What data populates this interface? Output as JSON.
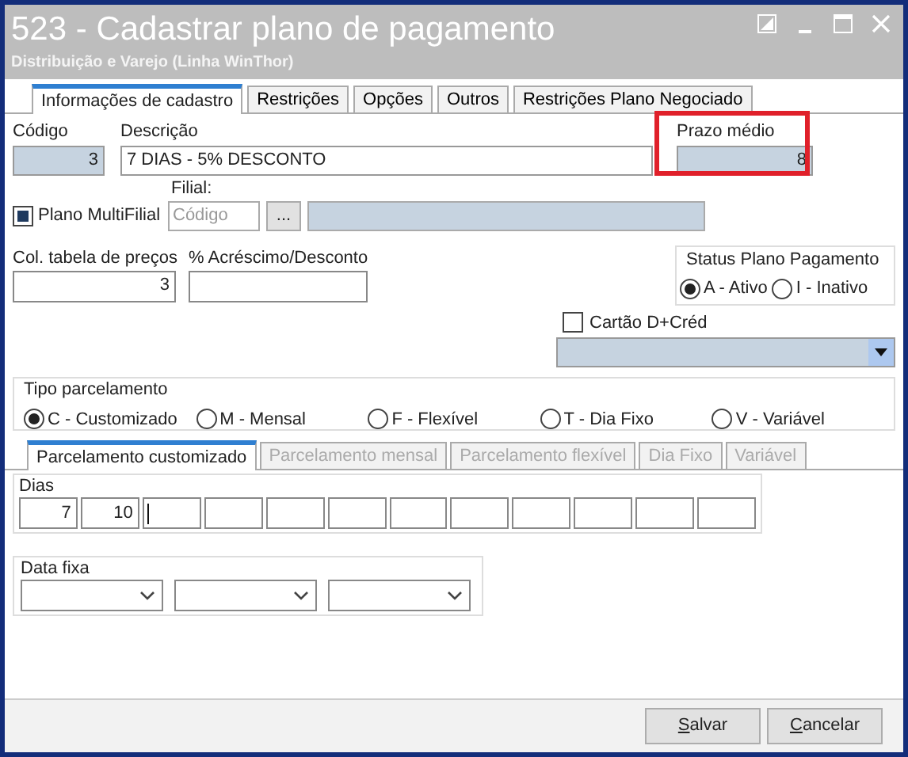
{
  "window": {
    "title": "523 - Cadastrar plano de pagamento",
    "subtitle": "Distribuição e Varejo (Linha WinThor)"
  },
  "tabs": [
    {
      "label": "Informações de cadastro",
      "selected": true
    },
    {
      "label": "Restrições",
      "selected": false
    },
    {
      "label": "Opções",
      "selected": false
    },
    {
      "label": "Outros",
      "selected": false
    },
    {
      "label": "Restrições Plano Negociado",
      "selected": false
    }
  ],
  "codigo": {
    "label": "Código",
    "value": "3"
  },
  "descricao": {
    "label": "Descrição",
    "value": "7 DIAS - 5% DESCONTO"
  },
  "prazo_medio": {
    "label": "Prazo médio",
    "value": "8",
    "highlighted": true
  },
  "filial": {
    "label": "Filial:",
    "code_placeholder": "Código",
    "lookup_button": "..."
  },
  "plano_multifilial": {
    "label": "Plano MultiFilial",
    "checked": true
  },
  "col_tabela": {
    "label": "Col. tabela de preços",
    "value": "3"
  },
  "acrescimo": {
    "label": "% Acréscimo/Desconto"
  },
  "status": {
    "label": "Status Plano Pagamento",
    "options": [
      {
        "label": "A - Ativo",
        "selected": true
      },
      {
        "label": "I - Inativo",
        "selected": false
      }
    ]
  },
  "cartao": {
    "label": "Cartão D+Créd",
    "checked": false
  },
  "tipo_parcelamento": {
    "label": "Tipo parcelamento",
    "options": [
      {
        "label": "C - Customizado",
        "selected": true
      },
      {
        "label": "M - Mensal",
        "selected": false
      },
      {
        "label": "F - Flexível",
        "selected": false
      },
      {
        "label": "T - Dia Fixo",
        "selected": false
      },
      {
        "label": "V - Variável",
        "selected": false
      }
    ]
  },
  "sub_tabs": [
    {
      "label": "Parcelamento customizado",
      "selected": true,
      "disabled": false
    },
    {
      "label": "Parcelamento mensal",
      "selected": false,
      "disabled": true
    },
    {
      "label": "Parcelamento flexível",
      "selected": false,
      "disabled": true
    },
    {
      "label": "Dia Fixo",
      "selected": false,
      "disabled": true
    },
    {
      "label": "Variável",
      "selected": false,
      "disabled": true
    }
  ],
  "dias": {
    "label": "Dias",
    "fields": [
      {
        "value": "7",
        "focused": false
      },
      {
        "value": "10",
        "focused": false
      },
      {
        "focused": true
      },
      {
        "focused": false
      },
      {
        "focused": false
      },
      {
        "focused": false
      },
      {
        "focused": false
      },
      {
        "focused": false
      },
      {
        "focused": false
      },
      {
        "focused": false
      },
      {
        "focused": false
      },
      {
        "focused": false
      }
    ]
  },
  "data_fixa": {
    "label": "Data fixa",
    "fields": [
      {
        "kind": "dropdown"
      },
      {
        "kind": "dropdown"
      },
      {
        "kind": "dropdown"
      }
    ]
  },
  "buttons": [
    {
      "label": "Salvar"
    },
    {
      "label": "Cancelar"
    }
  ]
}
